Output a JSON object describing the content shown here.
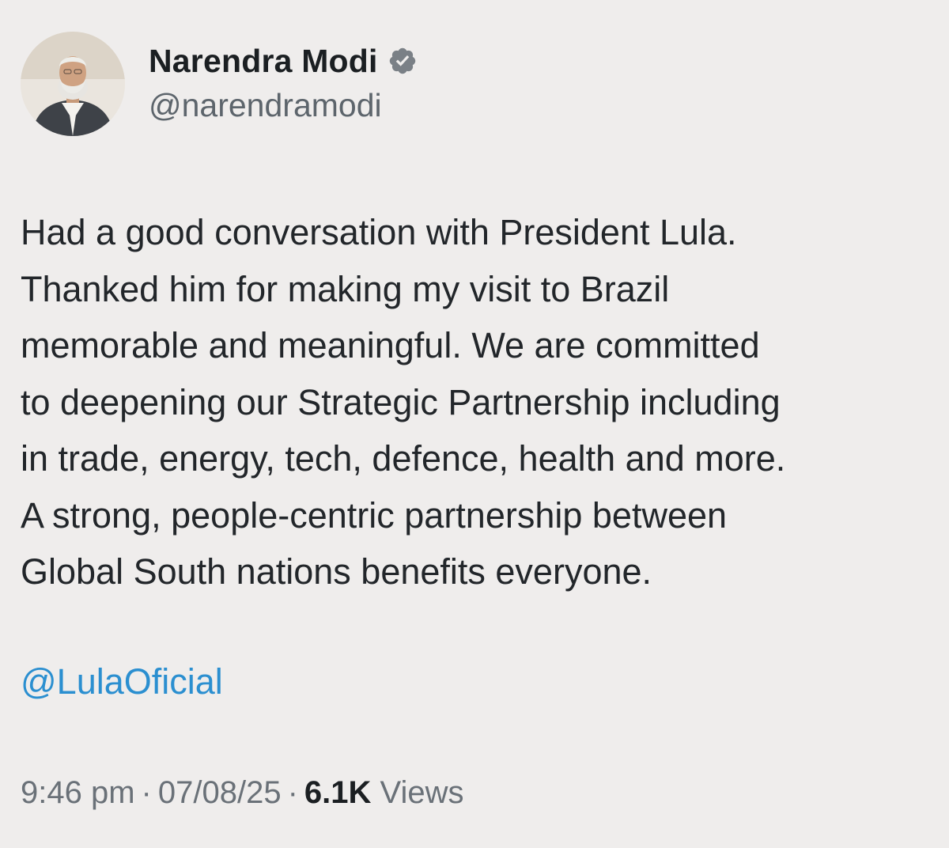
{
  "author": {
    "display_name": "Narendra Modi",
    "handle": "@narendramodi",
    "verified": true,
    "verified_badge_color": "#7a8086"
  },
  "tweet": {
    "text": "Had a good conversation with President Lula.\nThanked him for making my visit to Brazil\nmemorable and meaningful. We are committed\nto deepening our Strategic Partnership including\nin trade, energy, tech, defence, health and more.\nA strong, people-centric partnership between\nGlobal South nations benefits everyone.",
    "mention": "@LulaOficial",
    "mention_color": "#2b8fd0"
  },
  "meta": {
    "time": "9:46 pm",
    "date": "07/08/25",
    "separator": "·",
    "views_count": "6.1K",
    "views_label": "Views"
  },
  "theme": {
    "background": "#efedec",
    "text_color": "#22262a",
    "secondary_text": "#5d656c"
  }
}
